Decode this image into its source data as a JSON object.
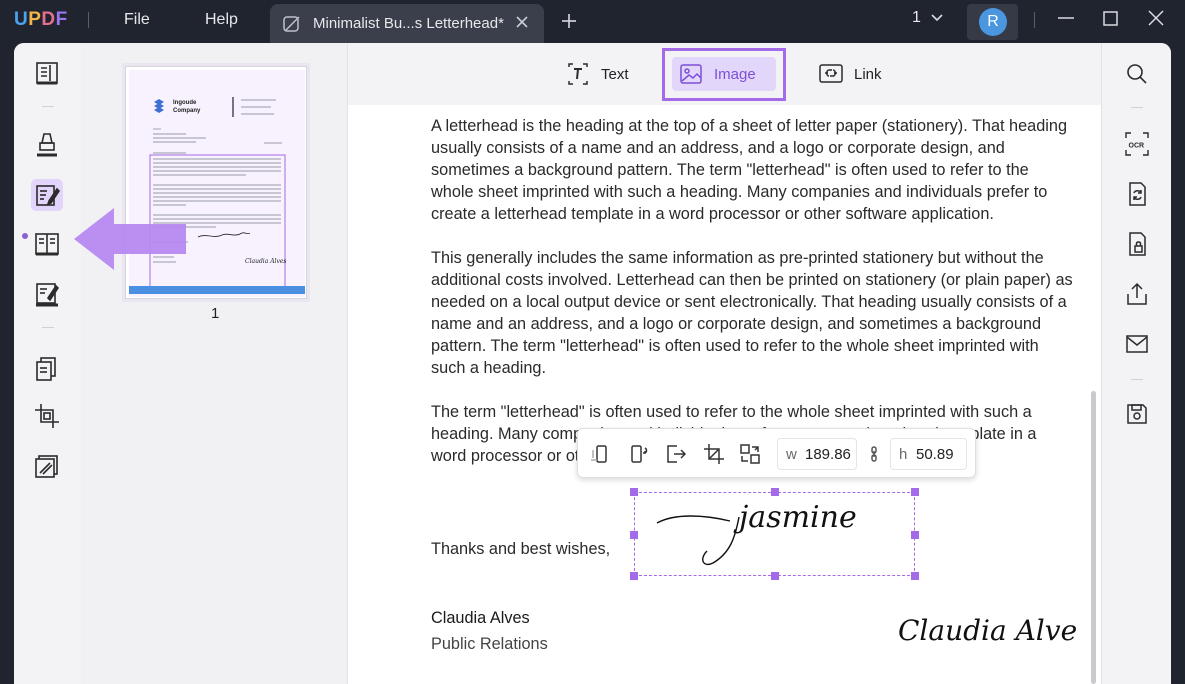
{
  "app": {
    "logo_text": "UPDF"
  },
  "menu": {
    "file": "File",
    "help": "Help"
  },
  "tab": {
    "title": "Minimalist Bu...s Letterhead*"
  },
  "toolbar": {
    "page_count": "1",
    "avatar_initial": "R"
  },
  "edit_modes": {
    "text": "Text",
    "image": "Image",
    "link": "Link"
  },
  "thumbnail": {
    "page_number": "1",
    "company_line1": "Ingoude",
    "company_line2": "Company",
    "signature_text": "Claudia Alves"
  },
  "document": {
    "paragraph1": "A letterhead is the heading at the top of a sheet of letter paper (stationery). That heading usually consists of a name and an address, and a logo or corporate design, and sometimes a background pattern. The term \"letterhead\" is often used to refer to the whole sheet imprinted with such a heading. Many companies and individuals prefer to create a letterhead template in a word processor or other software application.",
    "paragraph2": "This generally includes the same information as pre-printed stationery but without the additional costs involved. Letterhead can then be printed on stationery (or plain paper) as needed on a local output device or sent electronically. That heading usually consists of a name and an address, and a logo or corporate design, and sometimes a background pattern. The term \"letterhead\" is often used to refer to the whole sheet imprinted with such a heading.",
    "paragraph3_line1": "The term \"letterhead\" is often used to refer to the whole sheet imprinted with such a",
    "paragraph3_line2": "heading. Many companies and individuals prefer to create a letterhead template in a",
    "paragraph3_line3": "word processor or other software application.",
    "closing": "Thanks and best wishes,",
    "signature_image_text": "jasmine",
    "signer_name": "Claudia Alves",
    "signer_title": "Public Relations",
    "signature_script": "Claudia Alves"
  },
  "image_toolbar": {
    "width_label": "w",
    "width_value": "189.86",
    "height_label": "h",
    "height_value": "50.89"
  },
  "colors": {
    "accent": "#a46be9",
    "titlebar": "#20242e",
    "selection_fill": "#e3d6fb"
  }
}
